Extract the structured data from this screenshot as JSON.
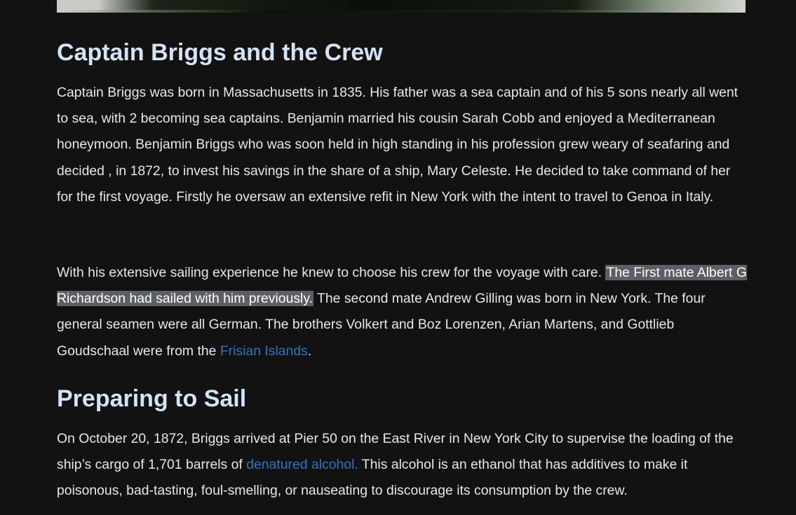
{
  "sections": [
    {
      "heading": "Captain Briggs and the Crew",
      "paragraph1": "Captain Briggs was born in Massachusetts in 1835. His father was a sea captain and of his 5 sons nearly all went to sea, with 2 becoming sea captains. Benjamin married his cousin Sarah Cobb and enjoyed a Mediterranean honeymoon. Benjamin Briggs who was soon held in high standing in his profession grew weary of seafaring and decided , in 1872, to invest his savings in the share of a ship, Mary Celeste. He decided to take command of her for the first voyage. Firstly he oversaw an extensive refit in New York with the intent to travel to Genoa in Italy.",
      "paragraph2": {
        "before": "With his extensive sailing experience he knew to choose his crew for the voyage with care. ",
        "highlighted": "The First mate Albert G Richardson had sailed with him previously.",
        "after": " The second mate Andrew Gilling was born in New York. The four general seamen were all German. The brothers Volkert and Boz Lorenzen, Arian Martens, and Gottlieb Goudschaal were from the ",
        "link": "Frisian Islands",
        "end": "."
      }
    },
    {
      "heading": "Preparing to Sail",
      "paragraph1": {
        "before": "On October 20, 1872, Briggs arrived at Pier 50 on the East River in New York City to supervise the loading of the ship’s cargo of 1,701 barrels of ",
        "link": "denatured alcohol.",
        "after": " This alcohol is an ethanol that has additives to make it poisonous, bad-tasting, foul-smelling, or nauseating to discourage its consumption by the crew."
      }
    }
  ],
  "colors": {
    "background": "#121212",
    "heading": "#d4e4f6",
    "text": "#e4e8ec",
    "link": "#2f74bd",
    "highlight": "#5c5f63"
  }
}
